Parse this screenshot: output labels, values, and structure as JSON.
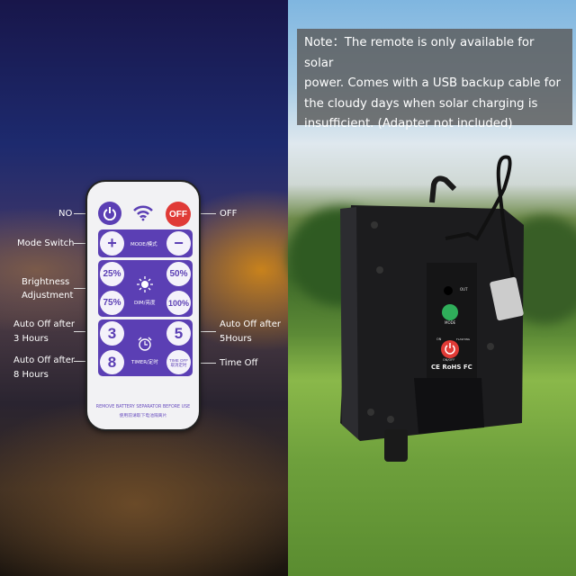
{
  "remote": {
    "labels": {
      "on": "NO",
      "off": "OFF",
      "mode_switch": "Mode Switch",
      "brightness_1": "Brightness",
      "brightness_2": "Adjustment",
      "auto3_1": "Auto Off after",
      "auto3_2": "3 Hours",
      "auto8_1": "Auto Off after",
      "auto8_2": "8 Hours",
      "auto5_1": "Auto Off after",
      "auto5_2": "5Hours",
      "time_off": "Time Off"
    },
    "buttons": {
      "off": "OFF",
      "plus": "+",
      "minus": "−",
      "b25": "25%",
      "b50": "50%",
      "b75": "75%",
      "b100": "100%",
      "t3": "3",
      "t5": "5",
      "t8": "8",
      "timeoff_1": "TIME OFF",
      "timeoff_2": "取消定时"
    },
    "panel_text": {
      "mode": "MODE/模式",
      "dim": "DIM/亮度",
      "timer": "TIMER/定时"
    },
    "footer_1": "REMOVE BATTERY SEPARATOR BEFORE USE",
    "footer_2": "使用前请取下电池隔离片",
    "accent": "#5b3fb4",
    "off_color": "#e03a36"
  },
  "note": {
    "lines": [
      "Note：The remote is only available for solar",
      "power. Comes with a USB backup cable for",
      "the cloudy days when solar charging is",
      "insufficient. (Adapter not included)"
    ]
  },
  "device": {
    "out": "OUT",
    "mode": "MODE",
    "on": "ON",
    "flashing": "FLASHING",
    "onoff": "ON/OFF",
    "certs": "CE RoHS FC",
    "mode_color": "#2fae5a",
    "power_color": "#e03a36"
  }
}
